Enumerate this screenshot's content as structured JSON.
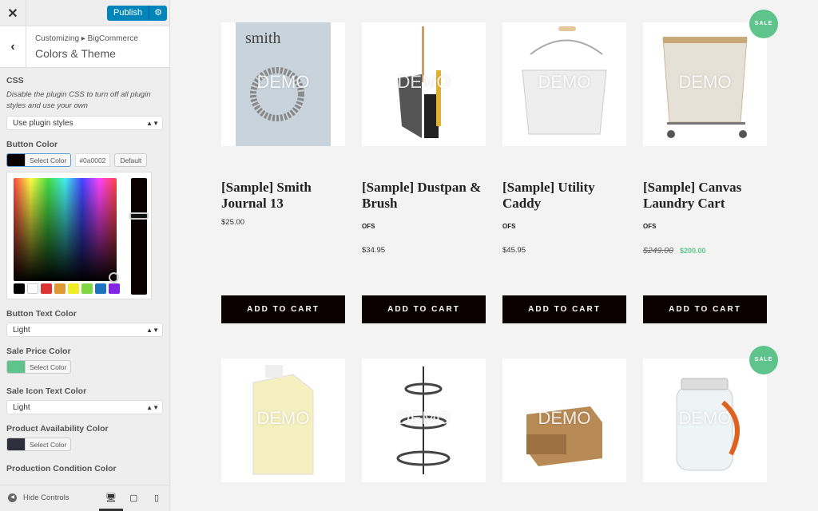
{
  "sidebar": {
    "publish_label": "Publish",
    "breadcrumb": "Customizing ▸ BigCommerce",
    "title": "Colors & Theme",
    "css": {
      "label": "CSS",
      "description": "Disable the plugin CSS to turn off all plugin styles and use your own",
      "value": "Use plugin styles"
    },
    "button_color": {
      "label": "Button Color",
      "select_label": "Select Color",
      "hex": "#0a0002",
      "default_label": "Default",
      "color": "#0a0002"
    },
    "palette": [
      "#000000",
      "#ffffff",
      "#dd3333",
      "#dd9933",
      "#eeee22",
      "#81d742",
      "#1e73be",
      "#8224e3"
    ],
    "button_text_color": {
      "label": "Button Text Color",
      "value": "Light"
    },
    "sale_price_color": {
      "label": "Sale Price Color",
      "select_label": "Select Color",
      "color": "#5fc48b"
    },
    "sale_icon_text_color": {
      "label": "Sale Icon Text Color",
      "value": "Light"
    },
    "availability_color": {
      "label": "Product Availability Color",
      "select_label": "Select Color",
      "color": "#2f2e3d"
    },
    "condition_color": {
      "label": "Production Condition Color"
    },
    "hide_controls": "Hide Controls"
  },
  "products": [
    {
      "title": "[Sample] Smith Journal 13",
      "price": "$25.00",
      "button": "ADD TO CART",
      "demo": "DEMO"
    },
    {
      "title": "[Sample] Dustpan & Brush",
      "availability": "OFS",
      "price": "$34.95",
      "button": "ADD TO CART",
      "demo": "DEMO"
    },
    {
      "title": "[Sample] Utility Caddy",
      "availability": "OFS",
      "price": "$45.95",
      "button": "ADD TO CART",
      "demo": "DEMO"
    },
    {
      "title": "[Sample] Canvas Laundry Cart",
      "availability": "OFS",
      "old_price": "$249.00",
      "sale_price": "$200.00",
      "button": "ADD TO CART",
      "badge": "SALE",
      "demo": "DEMO"
    },
    {
      "demo": "DEMO"
    },
    {
      "demo": "DEMO"
    },
    {
      "demo": "DEMO"
    },
    {
      "demo": "DEMO",
      "badge": "SALE"
    }
  ]
}
